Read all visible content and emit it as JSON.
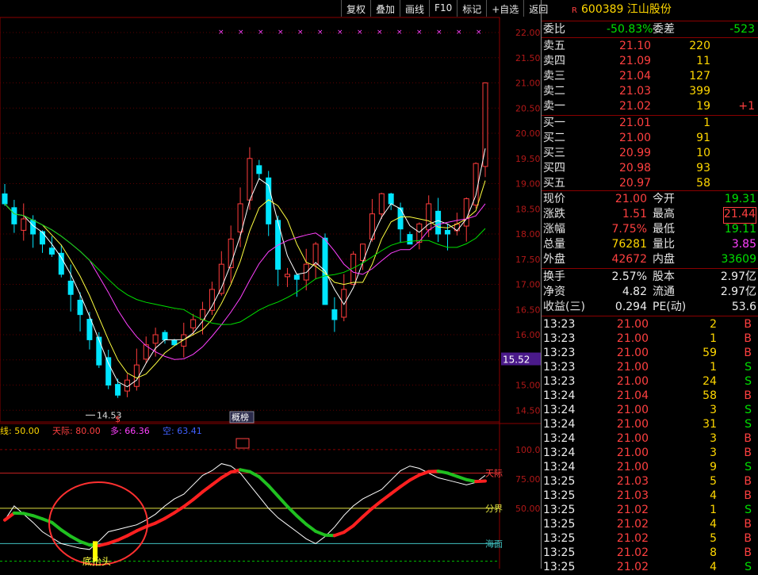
{
  "toolbar": [
    "复权",
    "叠加",
    "画线",
    "F10",
    "标记",
    "+自选",
    "返回"
  ],
  "stock": {
    "code": "600389",
    "name": "江山股份",
    "flag": "R"
  },
  "quote": {
    "ratio": {
      "label": "委比",
      "value": "-50.83%",
      "diff_label": "委差",
      "diff": "-523"
    },
    "asks": [
      {
        "label": "卖五",
        "price": "21.10",
        "vol": "220"
      },
      {
        "label": "卖四",
        "price": "21.09",
        "vol": "11"
      },
      {
        "label": "卖三",
        "price": "21.04",
        "vol": "127"
      },
      {
        "label": "卖二",
        "price": "21.03",
        "vol": "399"
      },
      {
        "label": "卖一",
        "price": "21.02",
        "vol": "19",
        "chg": "+1"
      }
    ],
    "bids": [
      {
        "label": "买一",
        "price": "21.01",
        "vol": "1"
      },
      {
        "label": "买二",
        "price": "21.00",
        "vol": "91"
      },
      {
        "label": "买三",
        "price": "20.99",
        "vol": "10"
      },
      {
        "label": "买四",
        "price": "20.98",
        "vol": "93"
      },
      {
        "label": "买五",
        "price": "20.97",
        "vol": "58"
      }
    ],
    "stats": [
      {
        "l1": "现价",
        "v1": "21.00",
        "c1": "red",
        "l2": "今开",
        "v2": "19.31",
        "c2": "grn"
      },
      {
        "l1": "涨跌",
        "v1": "1.51",
        "c1": "red",
        "l2": "最高",
        "v2": "21.44",
        "c2": "red"
      },
      {
        "l1": "涨幅",
        "v1": "7.75%",
        "c1": "red",
        "l2": "最低",
        "v2": "19.11",
        "c2": "grn"
      },
      {
        "l1": "总量",
        "v1": "76281",
        "c1": "yel",
        "l2": "量比",
        "v2": "3.85",
        "c2": "mag"
      },
      {
        "l1": "外盘",
        "v1": "42672",
        "c1": "red",
        "l2": "内盘",
        "v2": "33609",
        "c2": "grn"
      }
    ],
    "fund": [
      {
        "l1": "换手",
        "v1": "2.57%",
        "l2": "股本",
        "v2": "2.97亿"
      },
      {
        "l1": "净资",
        "v1": "4.82",
        "l2": "流通",
        "v2": "2.97亿"
      },
      {
        "l1": "收益(三)",
        "v1": "0.294",
        "l2": "PE(动)",
        "v2": "53.6"
      }
    ],
    "ticks": [
      {
        "t": "13:23",
        "p": "21.00",
        "v": "2",
        "s": "B"
      },
      {
        "t": "13:23",
        "p": "21.00",
        "v": "1",
        "s": "B"
      },
      {
        "t": "13:23",
        "p": "21.00",
        "v": "59",
        "s": "B"
      },
      {
        "t": "13:23",
        "p": "21.00",
        "v": "1",
        "s": "S"
      },
      {
        "t": "13:23",
        "p": "21.00",
        "v": "24",
        "s": "S"
      },
      {
        "t": "13:24",
        "p": "21.04",
        "v": "58",
        "s": "B"
      },
      {
        "t": "13:24",
        "p": "21.00",
        "v": "3",
        "s": "S"
      },
      {
        "t": "13:24",
        "p": "21.00",
        "v": "31",
        "s": "S"
      },
      {
        "t": "13:24",
        "p": "21.00",
        "v": "3",
        "s": "B"
      },
      {
        "t": "13:24",
        "p": "21.00",
        "v": "3",
        "s": "B"
      },
      {
        "t": "13:24",
        "p": "21.00",
        "v": "9",
        "s": "S"
      },
      {
        "t": "13:25",
        "p": "21.03",
        "v": "5",
        "s": "B"
      },
      {
        "t": "13:25",
        "p": "21.03",
        "v": "4",
        "s": "B"
      },
      {
        "t": "13:25",
        "p": "21.02",
        "v": "1",
        "s": "S"
      },
      {
        "t": "13:25",
        "p": "21.02",
        "v": "4",
        "s": "B"
      },
      {
        "t": "13:25",
        "p": "21.02",
        "v": "5",
        "s": "B"
      },
      {
        "t": "13:25",
        "p": "21.02",
        "v": "8",
        "s": "B"
      },
      {
        "t": "13:25",
        "p": "21.02",
        "v": "4",
        "s": "S"
      }
    ]
  },
  "chart_data": {
    "type": "candlestick",
    "price_ticks": [
      "22.00",
      "21.50",
      "21.00",
      "20.50",
      "20.00",
      "19.50",
      "19.00",
      "18.50",
      "18.00",
      "17.50",
      "17.00",
      "16.50",
      "16.00",
      "15.50",
      "15.00",
      "14.50"
    ],
    "ylim": [
      14.3,
      22.3
    ],
    "current_price_label": "15.52",
    "low_marker": "14.53",
    "closes": [
      18.6,
      18.2,
      18.3,
      18.0,
      17.8,
      17.6,
      17.2,
      16.8,
      16.4,
      15.9,
      15.4,
      15.0,
      14.8,
      15.1,
      15.4,
      15.8,
      16.0,
      15.9,
      15.8,
      16.0,
      16.3,
      16.5,
      16.9,
      17.4,
      17.9,
      18.6,
      19.5,
      19.2,
      18.2,
      17.3,
      17.2,
      17.1,
      17.4,
      17.8,
      16.6,
      16.3,
      16.9,
      17.6,
      17.8,
      18.4,
      18.8,
      18.6,
      18.1,
      17.8,
      18.2,
      18.6,
      18.0,
      18.0,
      18.2,
      18.7,
      19.4,
      21.0
    ],
    "overlay_labels": [
      "$",
      "概榜"
    ],
    "indicator": {
      "legend": [
        {
          "text": "线: 50.00",
          "color": "#ffd700"
        },
        {
          "text": "天际: 80.00",
          "color": "#ff4040"
        },
        {
          "text": "多: 66.36",
          "color": "#ff40ff"
        },
        {
          "text": "空: 63.41",
          "color": "#4060ff"
        }
      ],
      "ticks": [
        "100.0",
        "75.00",
        "50.00"
      ],
      "ylim": [
        0,
        110
      ],
      "levels": {
        "sky": 80,
        "mid": 50,
        "sea": 20,
        "floor": 5
      },
      "level_labels": [
        "天际",
        "分界",
        "海面"
      ],
      "annotation": "底抬头",
      "values": [
        40,
        52,
        45,
        38,
        30,
        25,
        20,
        18,
        16,
        15,
        22,
        30,
        32,
        34,
        36,
        40,
        45,
        52,
        58,
        62,
        70,
        78,
        82,
        88,
        86,
        80,
        70,
        60,
        50,
        42,
        36,
        30,
        24,
        20,
        26,
        34,
        44,
        52,
        58,
        62,
        66,
        74,
        82,
        86,
        84,
        80,
        76,
        74,
        72,
        70,
        72,
        78
      ]
    }
  }
}
